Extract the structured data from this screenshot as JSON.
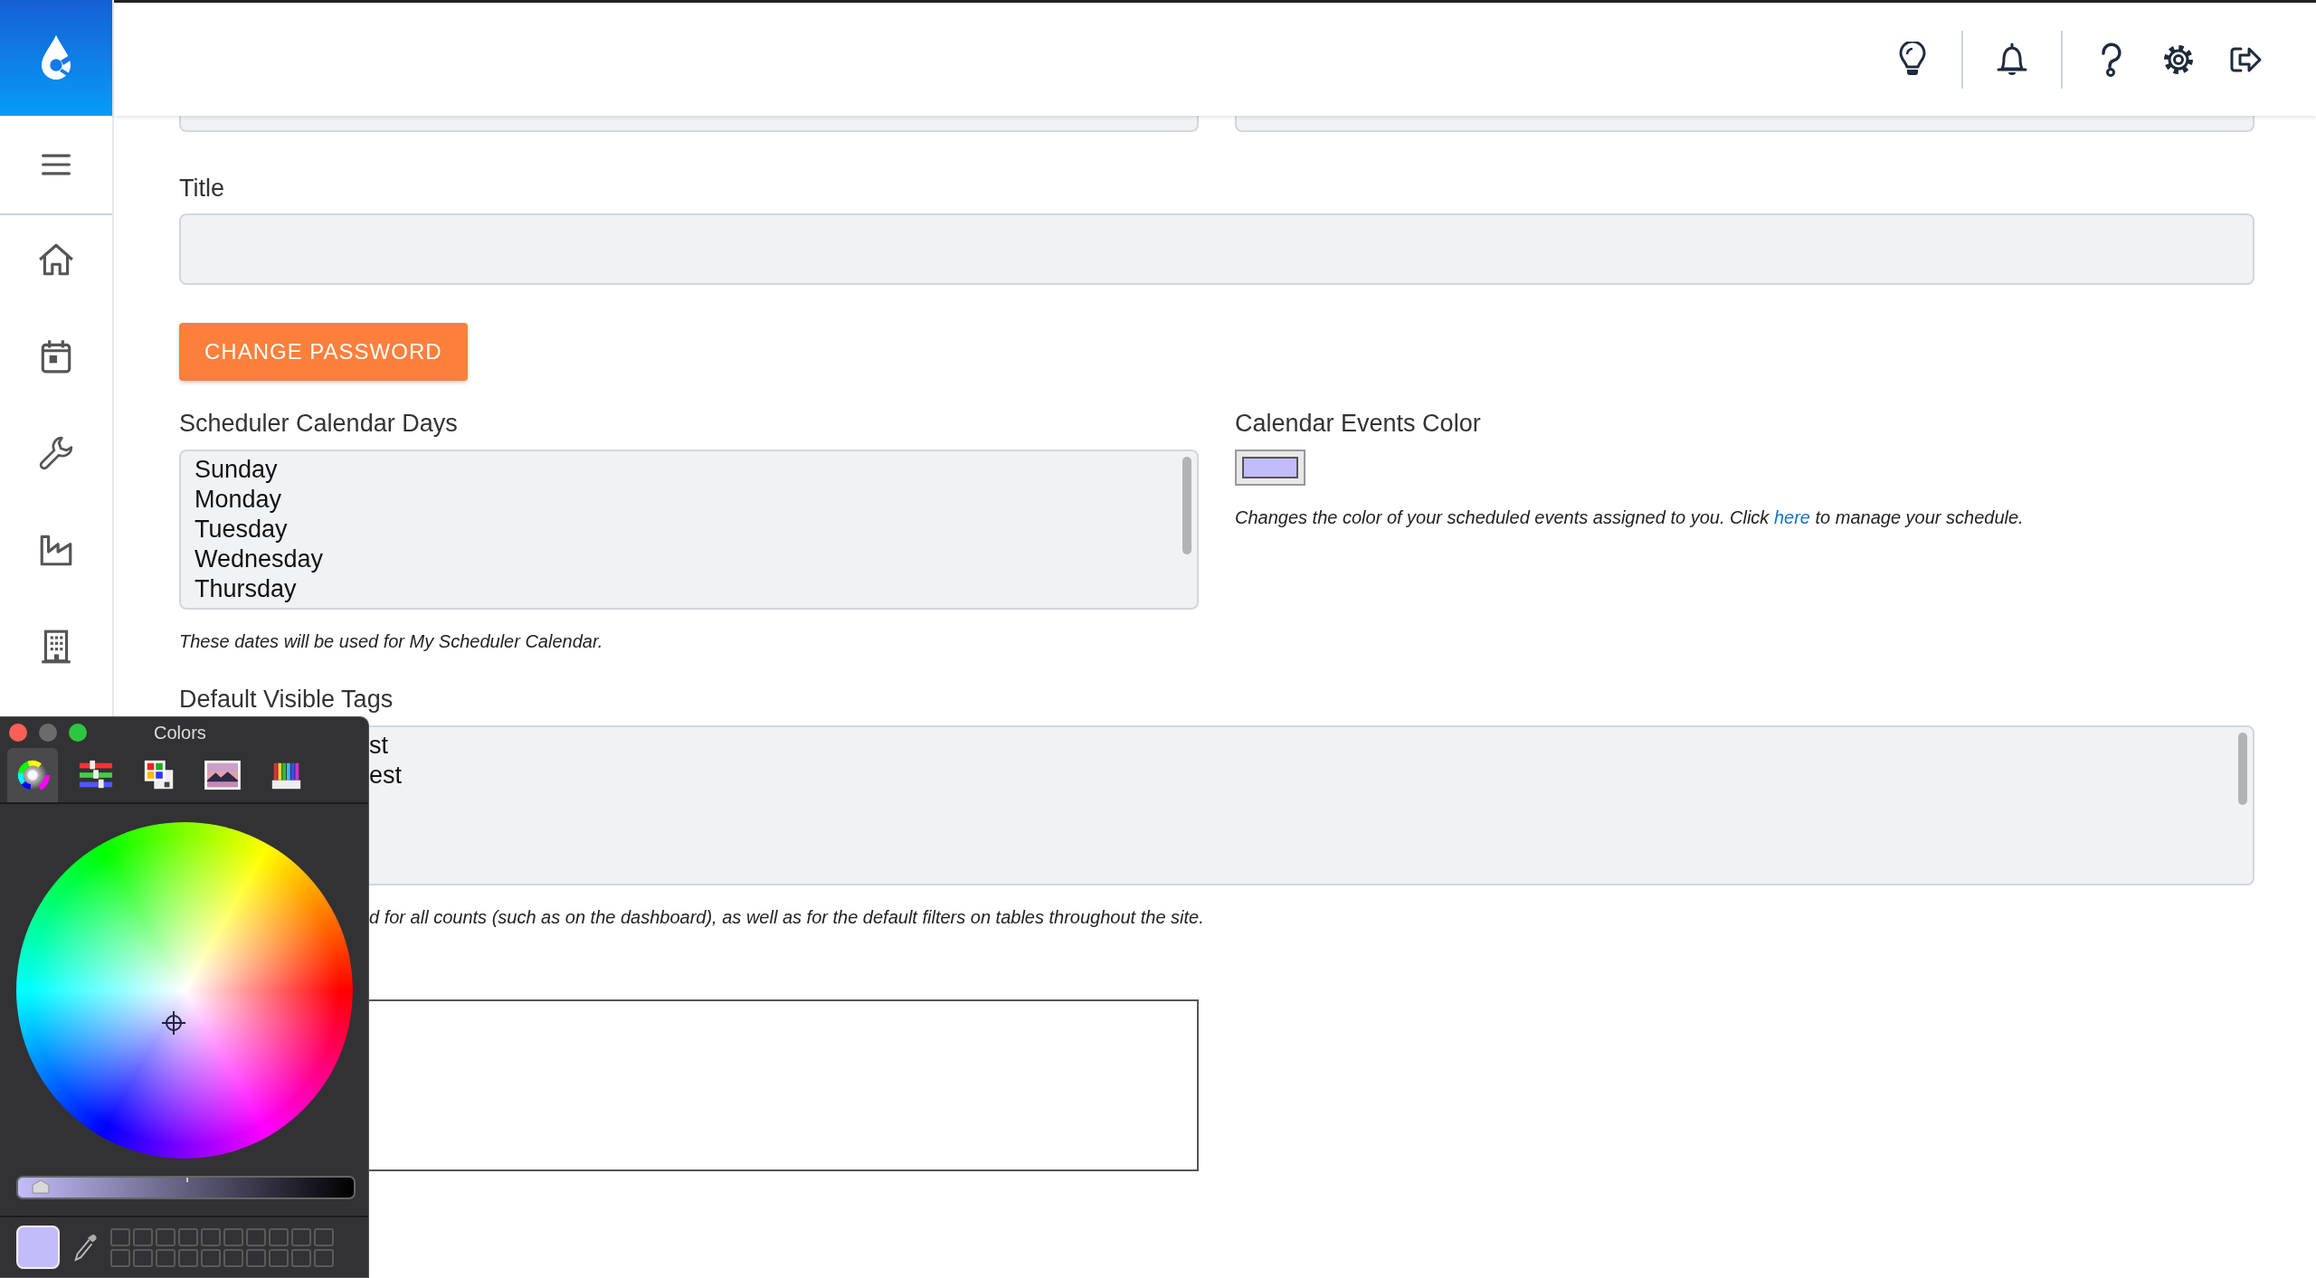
{
  "form": {
    "title_field": {
      "label": "Title"
    },
    "change_password_button": "CHANGE PASSWORD",
    "scheduler_calendar_days": {
      "label": "Scheduler Calendar Days",
      "options": [
        "Sunday",
        "Monday",
        "Tuesday",
        "Wednesday",
        "Thursday"
      ],
      "help": "These dates will be used for My Scheduler Calendar."
    },
    "calendar_events_color": {
      "label": "Calendar Events Color",
      "color": "#c3bcfb",
      "help_before": "Changes the color of your scheduled events assigned to you. Click ",
      "link": "here",
      "help_after": " to manage your schedule."
    },
    "default_visible_tags": {
      "label": "Default Visible Tags",
      "options": [
        "st",
        "est"
      ],
      "help": "d for all counts (such as on the dashboard), as well as for the default filters on tables throughout the site."
    }
  },
  "colors_panel": {
    "title": "Colors",
    "tabs": [
      {
        "kind": "wheel",
        "selected": true
      },
      {
        "kind": "sliders",
        "selected": false
      },
      {
        "kind": "palettes",
        "selected": false
      },
      {
        "kind": "image",
        "selected": false
      },
      {
        "kind": "pencils",
        "selected": false
      }
    ],
    "brightness": {
      "level": 0.04
    }
  }
}
